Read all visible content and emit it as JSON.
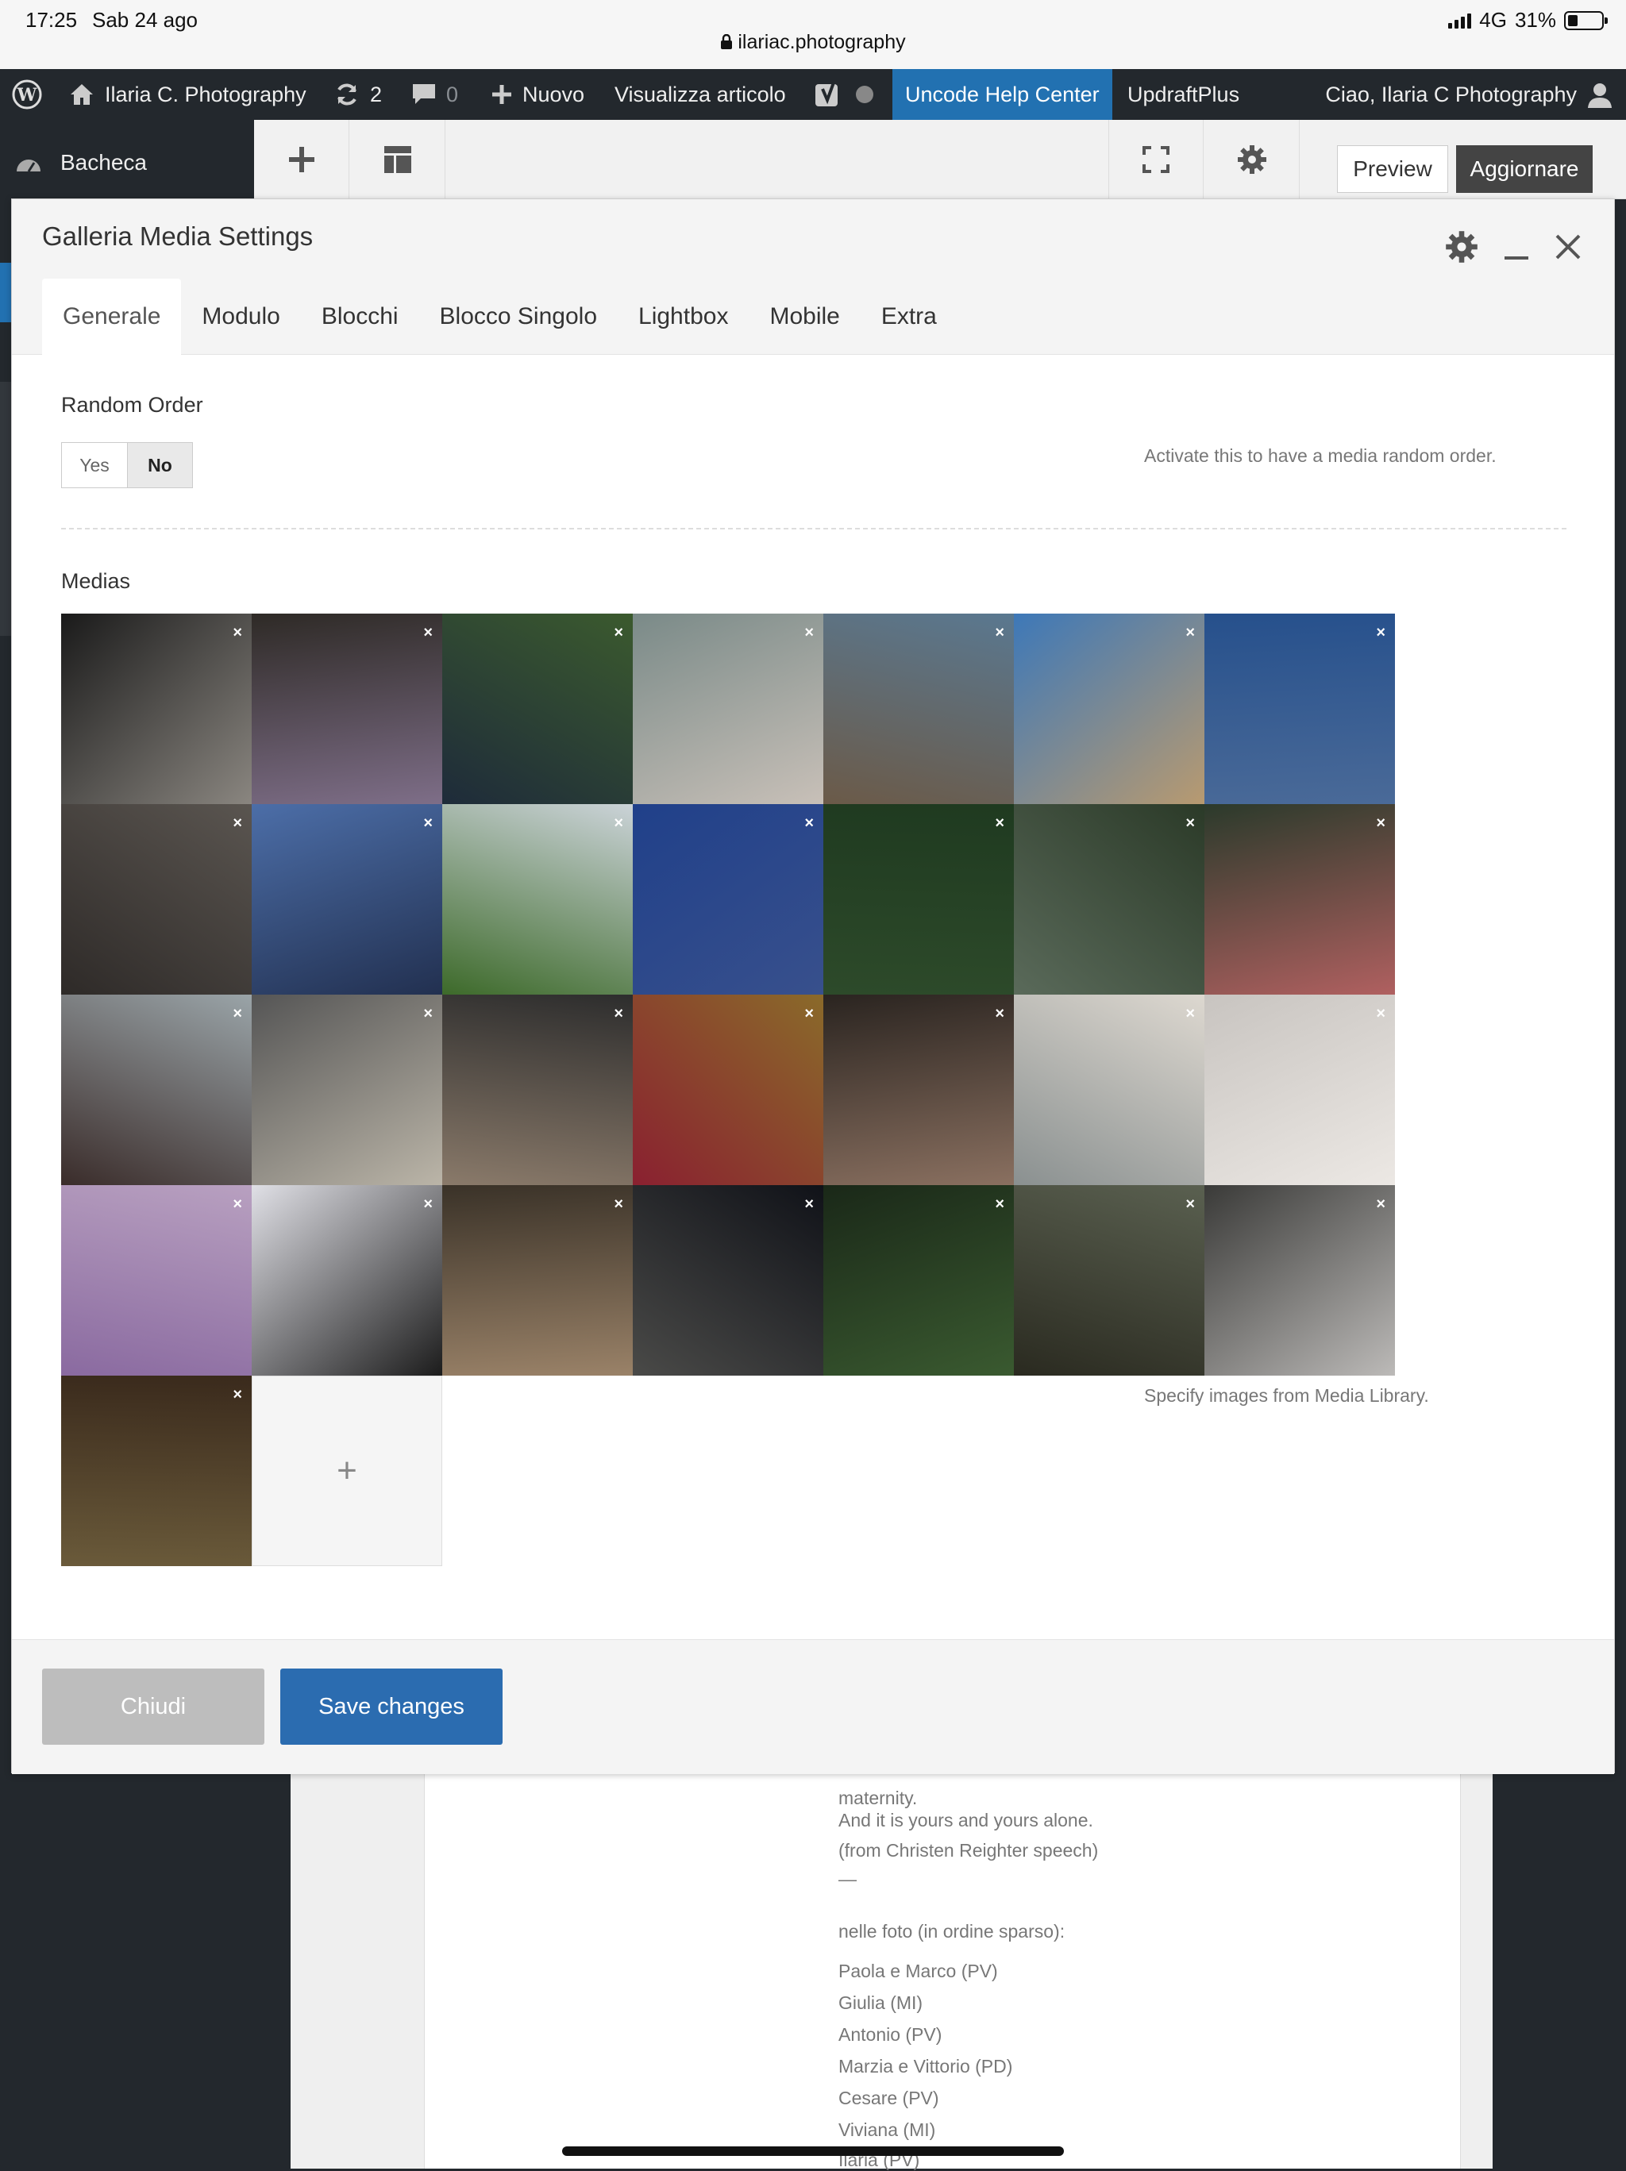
{
  "status": {
    "time": "17:25",
    "date": "Sab 24 ago",
    "url": "ilariac.photography",
    "network": "4G",
    "battery": "31%"
  },
  "adminbar": {
    "site": "Ilaria C. Photography",
    "updates": "2",
    "comments": "0",
    "new": "Nuovo",
    "view_post": "Visualizza articolo",
    "help_center": "Uncode Help Center",
    "updraft": "UpdraftPlus",
    "greeting": "Ciao, Ilaria C Photography"
  },
  "menu": {
    "dashboard": "Bacheca"
  },
  "toolbar": {
    "preview": "Preview",
    "update": "Aggiornare"
  },
  "modal": {
    "title": "Galleria Media Settings",
    "tabs": [
      {
        "label": "Generale",
        "active": true
      },
      {
        "label": "Modulo"
      },
      {
        "label": "Blocchi"
      },
      {
        "label": "Blocco Singolo"
      },
      {
        "label": "Lightbox"
      },
      {
        "label": "Mobile"
      },
      {
        "label": "Extra"
      }
    ],
    "random_order": {
      "label": "Random Order",
      "yes": "Yes",
      "no": "No",
      "selected": "No",
      "hint": "Activate this to have a media random order."
    },
    "medias": {
      "label": "Medias",
      "hint": "Specify images from Media Library.",
      "add": "+",
      "remove_glyph": "×",
      "thumbs": [
        [
          "#1a1a1a",
          "#8a8680"
        ],
        [
          "#2e2a26",
          "#7e6e88"
        ],
        [
          "#3b5a2e",
          "#1e2b3a"
        ],
        [
          "#7a8a88",
          "#c8c0b8"
        ],
        [
          "#5a7890",
          "#6b5a48"
        ],
        [
          "#3d78b8",
          "#b89a70"
        ],
        [
          "#26508c",
          "#4a6a98"
        ],
        [
          "#5a5550",
          "#2e2a28"
        ],
        [
          "#4c6ea8",
          "#223050"
        ],
        [
          "#cbd3d8",
          "#3d6a2a"
        ],
        [
          "#20408a",
          "#38508c"
        ],
        [
          "#1f3a20",
          "#2d4a2a"
        ],
        [
          "#2b3a28",
          "#5a6a5a"
        ],
        [
          "#2b3a2b",
          "#b06060"
        ],
        [
          "#9aa4a8",
          "#3a2c2a"
        ],
        [
          "#555555",
          "#bbb5a8"
        ],
        [
          "#2d2d2d",
          "#8a7a6a"
        ],
        [
          "#8a6a2a",
          "#8a2030"
        ],
        [
          "#2a2420",
          "#8a7060"
        ],
        [
          "#ddd8d0",
          "#8a9090"
        ],
        [
          "#c8c4c0",
          "#ece8e4"
        ],
        [
          "#b8a0c0",
          "#8a6aa0"
        ],
        [
          "#e0e0e6",
          "#1c1c1c"
        ],
        [
          "#3a3228",
          "#9a8268"
        ],
        [
          "#101218",
          "#4a4a48"
        ],
        [
          "#1a2818",
          "#3a5a30"
        ],
        [
          "#5a6050",
          "#2a2a20"
        ],
        [
          "#3a3a38",
          "#bcbab8"
        ],
        [
          "#3a2a1c",
          "#6a5a3a"
        ]
      ]
    },
    "footer": {
      "close": "Chiudi",
      "save": "Save changes"
    }
  },
  "background_text": [
    "maternity.",
    "And it is yours and yours alone.",
    "(from Christen Reighter speech)",
    "—",
    "nelle foto (in ordine sparso):",
    "Paola e Marco (PV)",
    "Giulia (MI)",
    "Antonio (PV)",
    "Marzia e Vittorio (PD)",
    "Cesare (PV)",
    "Viviana (MI)",
    "Ilaria (PV)"
  ]
}
